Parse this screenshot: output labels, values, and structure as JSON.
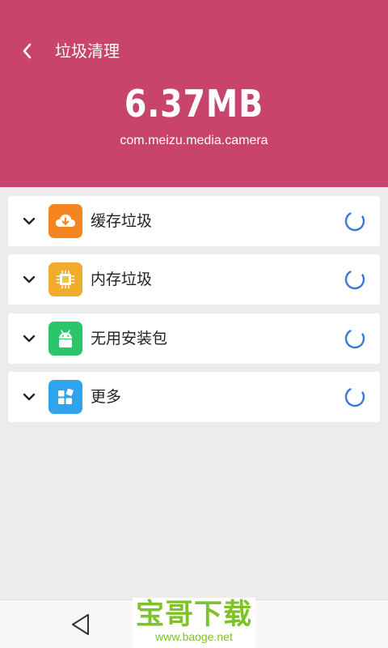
{
  "header": {
    "title": "垃圾清理",
    "size": "6.37MB",
    "package": "com.meizu.media.camera",
    "background": "#c9446c"
  },
  "categories": [
    {
      "label": "缓存垃圾",
      "icon": "cloud-download-icon",
      "color": "#f5861f"
    },
    {
      "label": "内存垃圾",
      "icon": "chip-icon",
      "color": "#f0ac2a"
    },
    {
      "label": "无用安装包",
      "icon": "android-icon",
      "color": "#2bc56a"
    },
    {
      "label": "更多",
      "icon": "apps-icon",
      "color": "#2ea3ee"
    }
  ],
  "spinner_color": "#3a78d8",
  "watermark": {
    "main": "宝哥下载",
    "sub": "www.baoge.net",
    "color": "#7dc229"
  }
}
